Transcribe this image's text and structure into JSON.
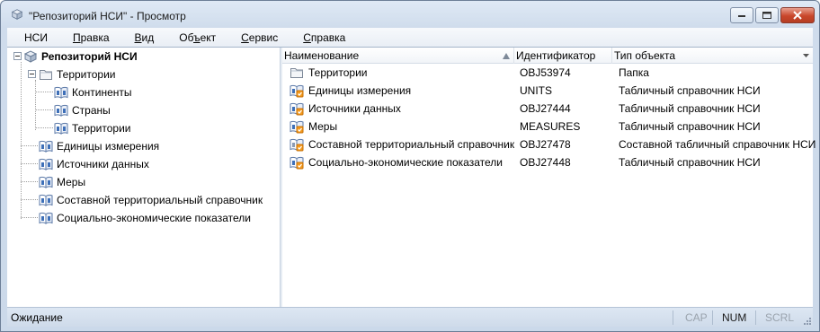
{
  "window": {
    "title": "\"Репозиторий НСИ\" - Просмотр"
  },
  "menu": [
    {
      "label": "НСИ",
      "accel": ""
    },
    {
      "label": "Правка",
      "accel": "П"
    },
    {
      "label": "Вид",
      "accel": "В"
    },
    {
      "label": "Объект",
      "accel": "О"
    },
    {
      "label": "Сервис",
      "accel": "С"
    },
    {
      "label": "Справка",
      "accel": "С"
    }
  ],
  "tree": {
    "root": "Репозиторий НСИ",
    "territories": "Территории",
    "continents": "Континенты",
    "countries": "Страны",
    "territories_sub": "Территории",
    "units": "Единицы измерения",
    "sources": "Источники данных",
    "measures": "Меры",
    "composite": "Составной территориальный справочник",
    "socio": "Социально-экономические показатели"
  },
  "list": {
    "columns": [
      "Наименование",
      "Идентификатор",
      "Тип объекта"
    ],
    "rows": [
      {
        "name": "Территории",
        "id": "OBJ53974",
        "type": "Папка",
        "icon": "folder-icon"
      },
      {
        "name": "Единицы измерения",
        "id": "UNITS",
        "type": "Табличный справочник НСИ",
        "icon": "table-dictionary-icon"
      },
      {
        "name": "Источники данных",
        "id": "OBJ27444",
        "type": "Табличный справочник НСИ",
        "icon": "table-dictionary-icon"
      },
      {
        "name": "Меры",
        "id": "MEASURES",
        "type": "Табличный справочник НСИ",
        "icon": "table-dictionary-icon"
      },
      {
        "name": "Составной территориальный справочник",
        "id": "OBJ27478",
        "type": "Составной табличный справочник НСИ",
        "icon": "composite-dictionary-icon"
      },
      {
        "name": "Социально-экономические показатели",
        "id": "OBJ27448",
        "type": "Табличный справочник НСИ",
        "icon": "table-dictionary-icon"
      }
    ]
  },
  "status": {
    "text": "Ожидание",
    "caps": "CAP",
    "num": "NUM",
    "scrl": "SCRL"
  }
}
